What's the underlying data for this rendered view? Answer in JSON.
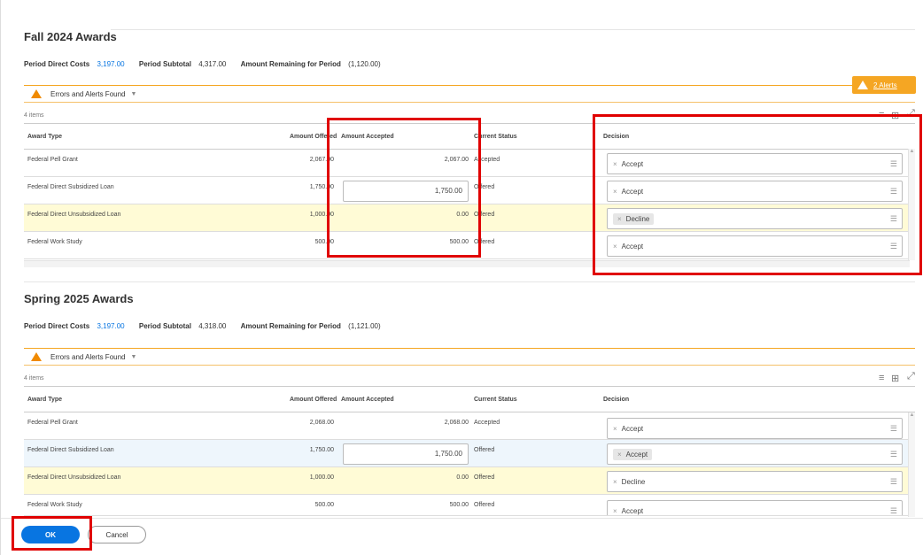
{
  "fall": {
    "title": "Fall 2024 Awards",
    "direct_costs_label": "Period Direct Costs",
    "direct_costs": "3,197.00",
    "subtotal_label": "Period Subtotal",
    "subtotal": "4,317.00",
    "remaining_label": "Amount Remaining for Period",
    "remaining": "(1,120.00)",
    "alerts_label": "Errors and Alerts Found",
    "items_count": "4 items",
    "badge": "2 Alerts",
    "headers": {
      "award": "Award Type",
      "offered": "Amount Offered",
      "accepted": "Amount Accepted",
      "status": "Current Status",
      "decision": "Decision"
    },
    "rows": [
      {
        "award": "Federal Pell Grant",
        "offered": "2,067.00",
        "accepted": "2,067.00",
        "status": "Accepted",
        "decision": "Accept"
      },
      {
        "award": "Federal Direct Subsidized Loan",
        "offered": "1,750.00",
        "accepted": "1,750.00",
        "status": "Offered",
        "decision": "Accept"
      },
      {
        "award": "Federal Direct Unsubsidized Loan",
        "offered": "1,000.00",
        "accepted": "0.00",
        "status": "Offered",
        "decision": "Decline"
      },
      {
        "award": "Federal Work Study",
        "offered": "500.00",
        "accepted": "500.00",
        "status": "Offered",
        "decision": "Accept"
      }
    ]
  },
  "spring": {
    "title": "Spring 2025 Awards",
    "direct_costs_label": "Period Direct Costs",
    "direct_costs": "3,197.00",
    "subtotal_label": "Period Subtotal",
    "subtotal": "4,318.00",
    "remaining_label": "Amount Remaining for Period",
    "remaining": "(1,121.00)",
    "alerts_label": "Errors and Alerts Found",
    "items_count": "4 items",
    "headers": {
      "award": "Award Type",
      "offered": "Amount Offered",
      "accepted": "Amount Accepted",
      "status": "Current Status",
      "decision": "Decision"
    },
    "rows": [
      {
        "award": "Federal Pell Grant",
        "offered": "2,068.00",
        "accepted": "2,068.00",
        "status": "Accepted",
        "decision": "Accept"
      },
      {
        "award": "Federal Direct Subsidized Loan",
        "offered": "1,750.00",
        "accepted": "1,750.00",
        "status": "Offered",
        "decision": "Accept"
      },
      {
        "award": "Federal Direct Unsubsidized Loan",
        "offered": "1,000.00",
        "accepted": "0.00",
        "status": "Offered",
        "decision": "Decline"
      },
      {
        "award": "Federal Work Study",
        "offered": "500.00",
        "accepted": "500.00",
        "status": "Offered",
        "decision": "Accept"
      }
    ]
  },
  "footer": {
    "ok": "OK",
    "cancel": "Cancel"
  },
  "colors": {
    "accent": "#0875e1",
    "warning": "#f5a623",
    "highlight": "#e00000"
  }
}
